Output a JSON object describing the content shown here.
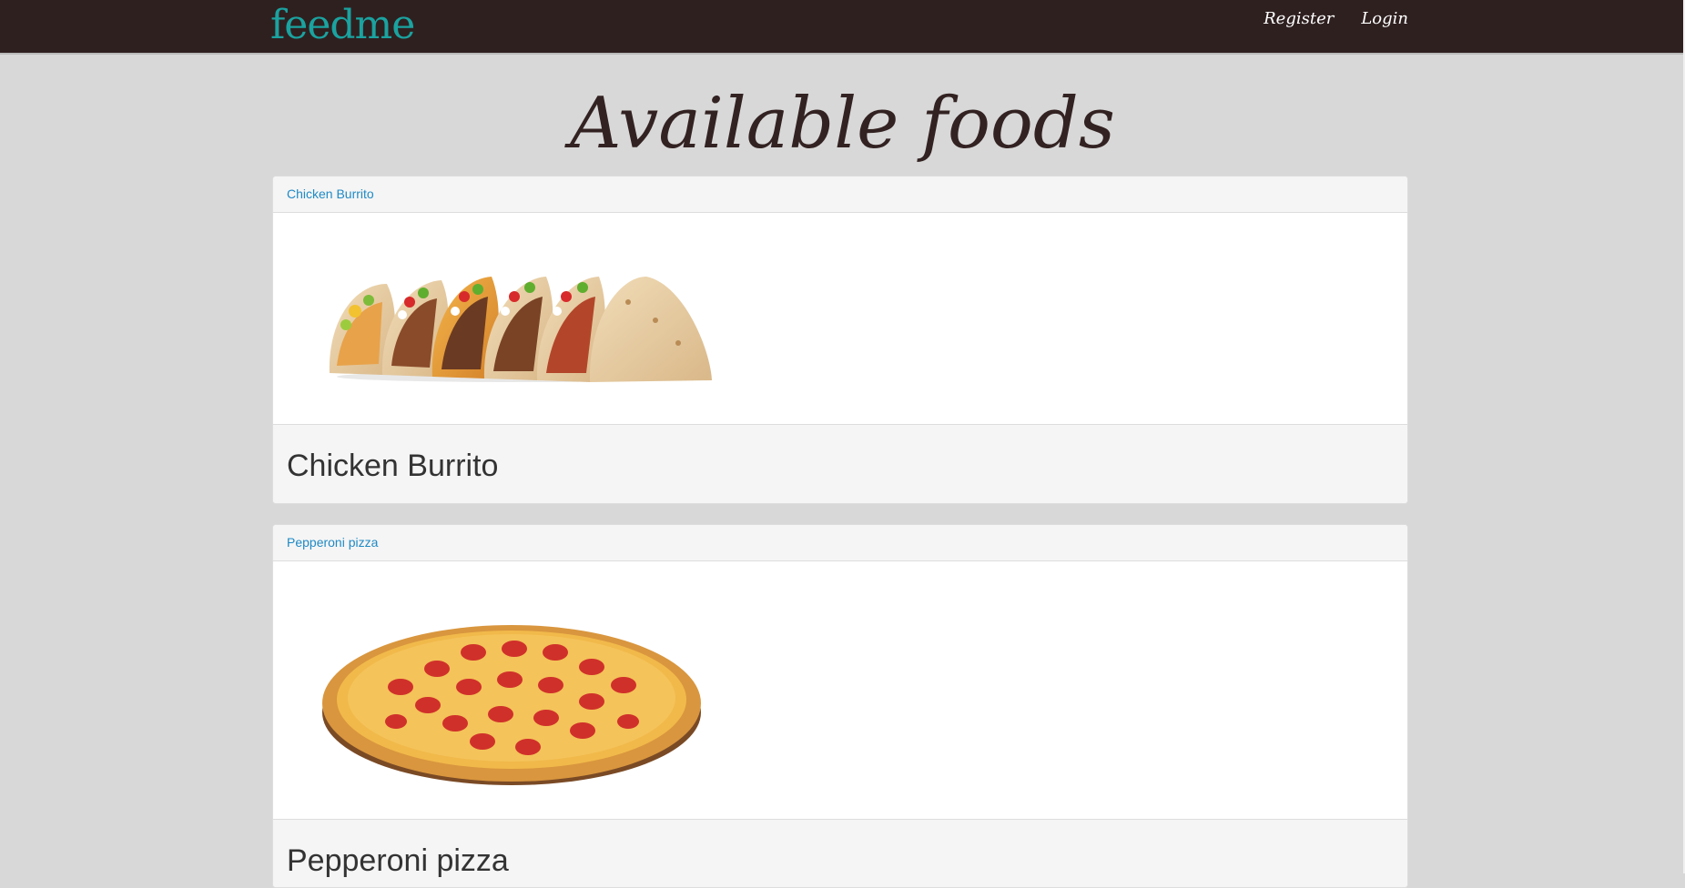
{
  "app": {
    "logo_text": "feedme",
    "brand_color": "#1aa3a0",
    "nav_background": "#2f2020"
  },
  "nav": {
    "register_label": "Register",
    "login_label": "Login"
  },
  "page": {
    "title": "Available foods"
  },
  "foods": [
    {
      "link_label": "Chicken Burrito",
      "name": "Chicken Burrito",
      "image_icon": "tacos-image"
    },
    {
      "link_label": "Pepperoni pizza",
      "name": "Pepperoni pizza",
      "image_icon": "pizza-image"
    }
  ]
}
